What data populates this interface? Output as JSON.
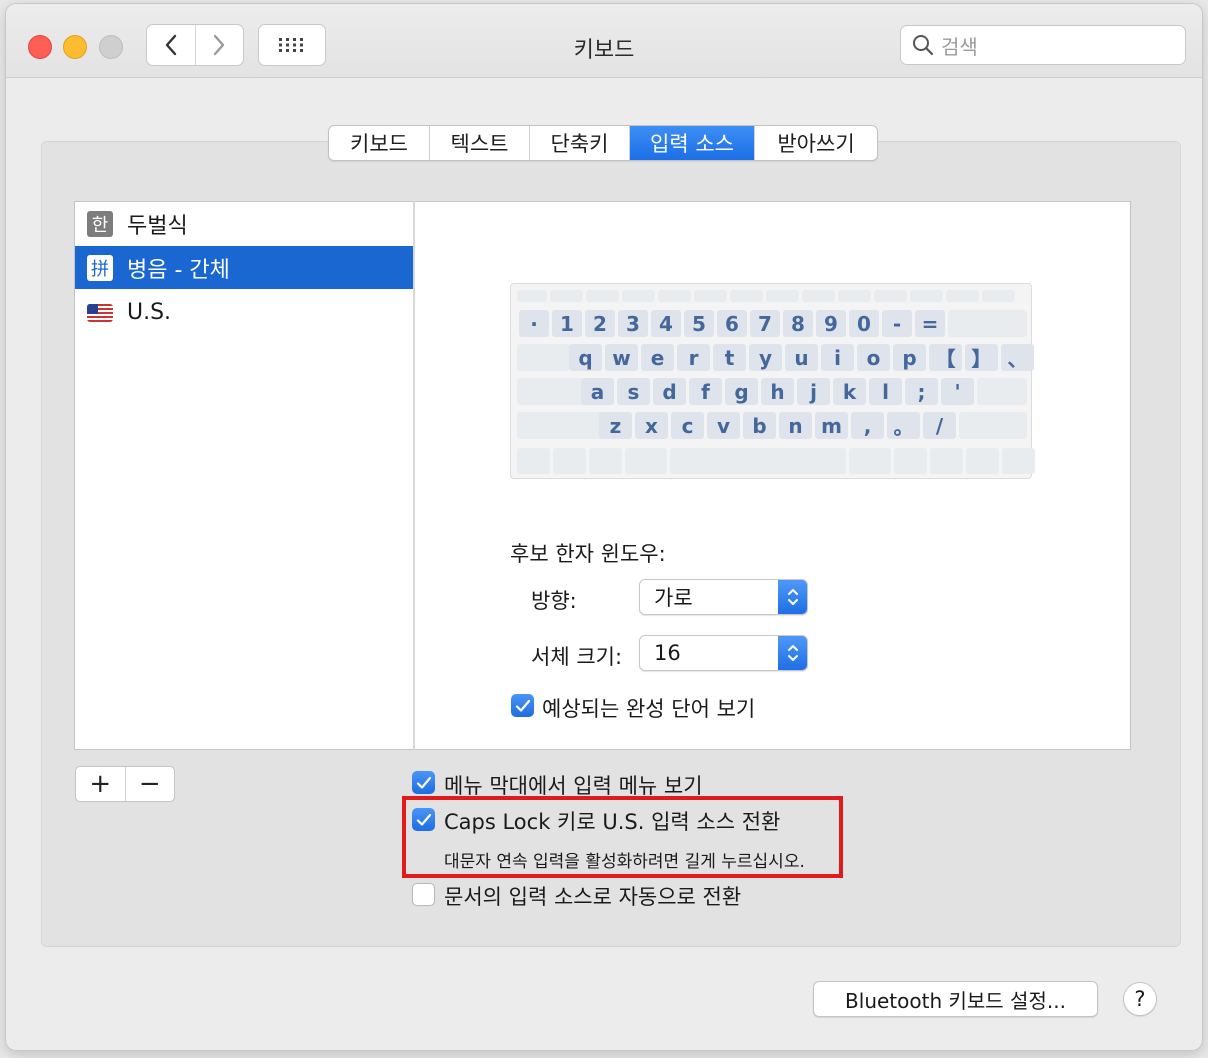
{
  "window": {
    "title": "키보드"
  },
  "toolbar": {
    "search_placeholder": "검색"
  },
  "tabs": [
    {
      "label": "키보드",
      "active": false
    },
    {
      "label": "텍스트",
      "active": false
    },
    {
      "label": "단축키",
      "active": false
    },
    {
      "label": "입력 소스",
      "active": true
    },
    {
      "label": "받아쓰기",
      "active": false
    }
  ],
  "input_sources": [
    {
      "icon_text": "한",
      "label": "두벌식",
      "selected": false
    },
    {
      "icon_text": "拼",
      "label": "병음 - 간체",
      "selected": true
    },
    {
      "icon": "us-flag-icon",
      "label": "U.S.",
      "selected": false
    }
  ],
  "keyboard_rows": [
    [
      "·",
      "1",
      "2",
      "3",
      "4",
      "5",
      "6",
      "7",
      "8",
      "9",
      "0",
      "-",
      "="
    ],
    [
      "q",
      "w",
      "e",
      "r",
      "t",
      "y",
      "u",
      "i",
      "o",
      "p",
      "【",
      "】",
      "、"
    ],
    [
      "a",
      "s",
      "d",
      "f",
      "g",
      "h",
      "j",
      "k",
      "l",
      ";",
      "'"
    ],
    [
      "z",
      "x",
      "c",
      "v",
      "b",
      "n",
      "m",
      ",",
      "。",
      "/"
    ]
  ],
  "candidate": {
    "title": "후보 한자 윈도우:",
    "direction_label": "방향:",
    "direction_value": "가로",
    "font_size_label": "서체 크기:",
    "font_size_value": "16",
    "predictive_label": "예상되는 완성 단어 보기",
    "predictive_checked": true
  },
  "add_remove": {
    "add": "+",
    "remove": "−"
  },
  "options": {
    "show_menu_label": "메뉴 막대에서 입력 메뉴 보기",
    "show_menu_checked": true,
    "caps_lock_label": "Caps Lock 키로 U.S. 입력 소스 전환",
    "caps_lock_checked": true,
    "caps_lock_sub": "대문자 연속 입력을 활성화하려면 길게 누르십시오.",
    "auto_switch_label": "문서의 입력 소스로 자동으로 전환",
    "auto_switch_checked": false
  },
  "footer": {
    "bluetooth_button": "Bluetooth 키보드 설정...",
    "help_button": "?"
  },
  "colors": {
    "accent": "#1b67d2",
    "highlight_border": "#e01b1b"
  }
}
